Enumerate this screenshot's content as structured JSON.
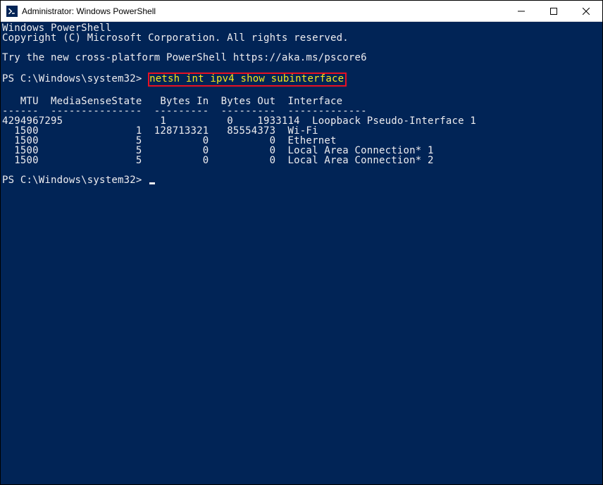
{
  "window": {
    "title": "Administrator: Windows PowerShell"
  },
  "terminal": {
    "banner1": "Windows PowerShell",
    "banner2": "Copyright (C) Microsoft Corporation. All rights reserved.",
    "banner3": "Try the new cross-platform PowerShell https://aka.ms/pscore6",
    "prompt1_prefix": "PS C:\\Windows\\system32> ",
    "command1": "netsh int ipv4 show subinterface",
    "table_header": "   MTU  MediaSenseState   Bytes In  Bytes Out  Interface",
    "table_divider": "------  ---------------  ---------  ---------  -------------",
    "rows": [
      "4294967295                1          0    1933114  Loopback Pseudo-Interface 1",
      "  1500                1  128713321   85554373  Wi-Fi",
      "  1500                5          0          0  Ethernet",
      "  1500                5          0          0  Local Area Connection* 1",
      "  1500                5          0          0  Local Area Connection* 2"
    ],
    "prompt2_prefix": "PS C:\\Windows\\system32> "
  }
}
